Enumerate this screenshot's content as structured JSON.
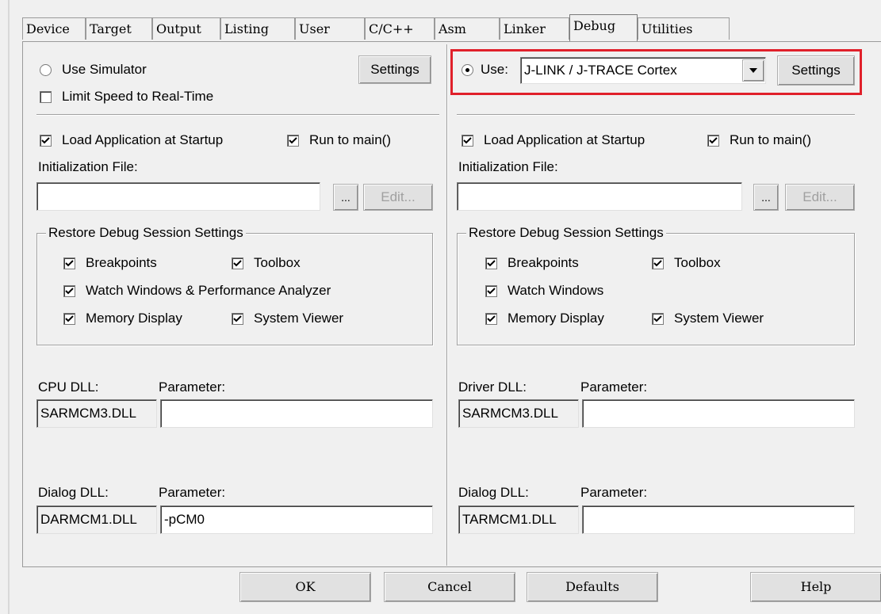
{
  "tabs": [
    "Device",
    "Target",
    "Output",
    "Listing",
    "User",
    "C/C++",
    "Asm",
    "Linker",
    "Debug",
    "Utilities"
  ],
  "active_tab": "Debug",
  "left": {
    "use_simulator_label": "Use Simulator",
    "limit_speed_label": "Limit Speed to Real-Time",
    "settings_label": "Settings",
    "load_app_label": "Load Application at Startup",
    "run_to_main_label": "Run to main()",
    "init_file_label": "Initialization File:",
    "browse_label": "...",
    "edit_label": "Edit...",
    "restore_title": "Restore Debug Session Settings",
    "breakpoints_label": "Breakpoints",
    "toolbox_label": "Toolbox",
    "watch_label": "Watch Windows & Performance Analyzer",
    "memory_label": "Memory Display",
    "system_viewer_label": "System Viewer",
    "cpu_dll_label": "CPU DLL:",
    "cpu_param_label": "Parameter:",
    "cpu_dll_value": "SARMCM3.DLL",
    "cpu_param_value": "",
    "dialog_dll_label": "Dialog DLL:",
    "dialog_param_label": "Parameter:",
    "dialog_dll_value": "DARMCM1.DLL",
    "dialog_param_value": "-pCM0"
  },
  "right": {
    "use_label": "Use:",
    "driver_value": "J-LINK / J-TRACE Cortex",
    "settings_label": "Settings",
    "load_app_label": "Load Application at Startup",
    "run_to_main_label": "Run to main()",
    "init_file_label": "Initialization File:",
    "browse_label": "...",
    "edit_label": "Edit...",
    "restore_title": "Restore Debug Session Settings",
    "breakpoints_label": "Breakpoints",
    "toolbox_label": "Toolbox",
    "watch_label": "Watch Windows",
    "memory_label": "Memory Display",
    "system_viewer_label": "System Viewer",
    "driver_dll_label": "Driver DLL:",
    "driver_param_label": "Parameter:",
    "driver_dll_value": "SARMCM3.DLL",
    "driver_param_value": "",
    "dialog_dll_label": "Dialog DLL:",
    "dialog_param_label": "Parameter:",
    "dialog_dll_value": "TARMCM1.DLL",
    "dialog_param_value": ""
  },
  "footer": {
    "ok_label": "OK",
    "cancel_label": "Cancel",
    "defaults_label": "Defaults",
    "help_label": "Help"
  },
  "colors": {
    "highlight_box": "#e0202a",
    "dialog_bg": "#f0f0f0"
  }
}
